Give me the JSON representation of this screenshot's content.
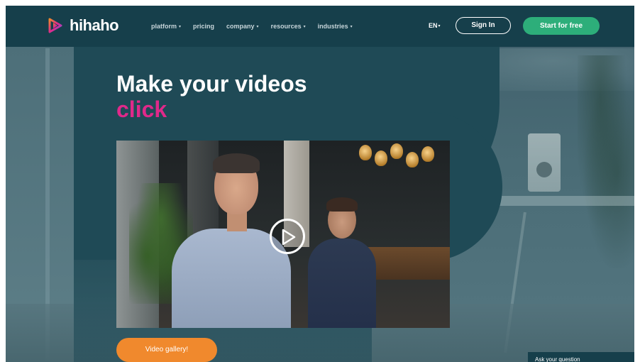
{
  "brand": {
    "name": "hihaho"
  },
  "nav": {
    "menu": [
      {
        "label": "platform",
        "caret": true
      },
      {
        "label": "pricing",
        "caret": false
      },
      {
        "label": "company",
        "caret": true
      },
      {
        "label": "resources",
        "caret": true
      },
      {
        "label": "industries",
        "caret": true
      }
    ],
    "language": "EN",
    "sign_in": "Sign In",
    "start": "Start for free"
  },
  "hero": {
    "line1": "Make your videos",
    "line2": "click"
  },
  "video": {
    "play_icon": "play-icon"
  },
  "gallery_button": "Video gallery!",
  "chat": {
    "label": "Ask your question"
  },
  "colors": {
    "nav_bg": "#163f4b",
    "accent_pink": "#e0298a",
    "cta_green": "#2dae7a",
    "gallery_orange": "#f0892d"
  }
}
